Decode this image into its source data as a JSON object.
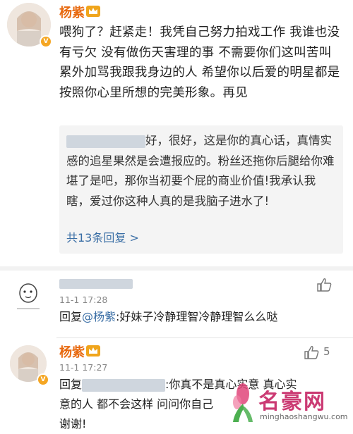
{
  "post": {
    "username": "杨紫",
    "text": "喂狗了？赶紧走！我凭自己努力拍戏工作 我谁也没有亏欠 没有做伤天害理的事 不需要你们这叫苦叫累外加骂我跟我身边的人 希望你以后爱的明星都是按照你心里所想的完美形象。再见",
    "quote": {
      "text_after_name": "好，很好，这是你的真心话，真情实感的追星果然是会遭报应的。粉丝还拖你后腿给你难堪了是吧，那你当初要个屁的商业价值!我承认我瞎，爱过你这种人真的是我脑子进水了!",
      "reply_count": "共13条回复 >"
    }
  },
  "comments": [
    {
      "timestamp": "11-1 17:28",
      "reply_prefix": "回复",
      "mention": "@杨紫",
      "text": ":好妹子冷静理智冷静理智么么哒"
    },
    {
      "username": "杨紫",
      "timestamp": "11-1 17:27",
      "like_count": "5",
      "reply_prefix": "回复",
      "text_line1": ":你真不是真心实意 真心实",
      "text_line2": "意的人 都不会这样 问问你自己",
      "text_line3": "谢谢!"
    }
  ],
  "watermark": {
    "title": "名豪网",
    "url": "minghaoshangwu.com"
  },
  "colors": {
    "username": "#e86a10",
    "link": "#3a6ea5",
    "quote_bg": "#f4f4f4",
    "badge": "#f5a623"
  },
  "icons": [
    "avatar",
    "verified-badge-icon",
    "crown-icon",
    "like-icon",
    "watermark-logo-icon"
  ]
}
